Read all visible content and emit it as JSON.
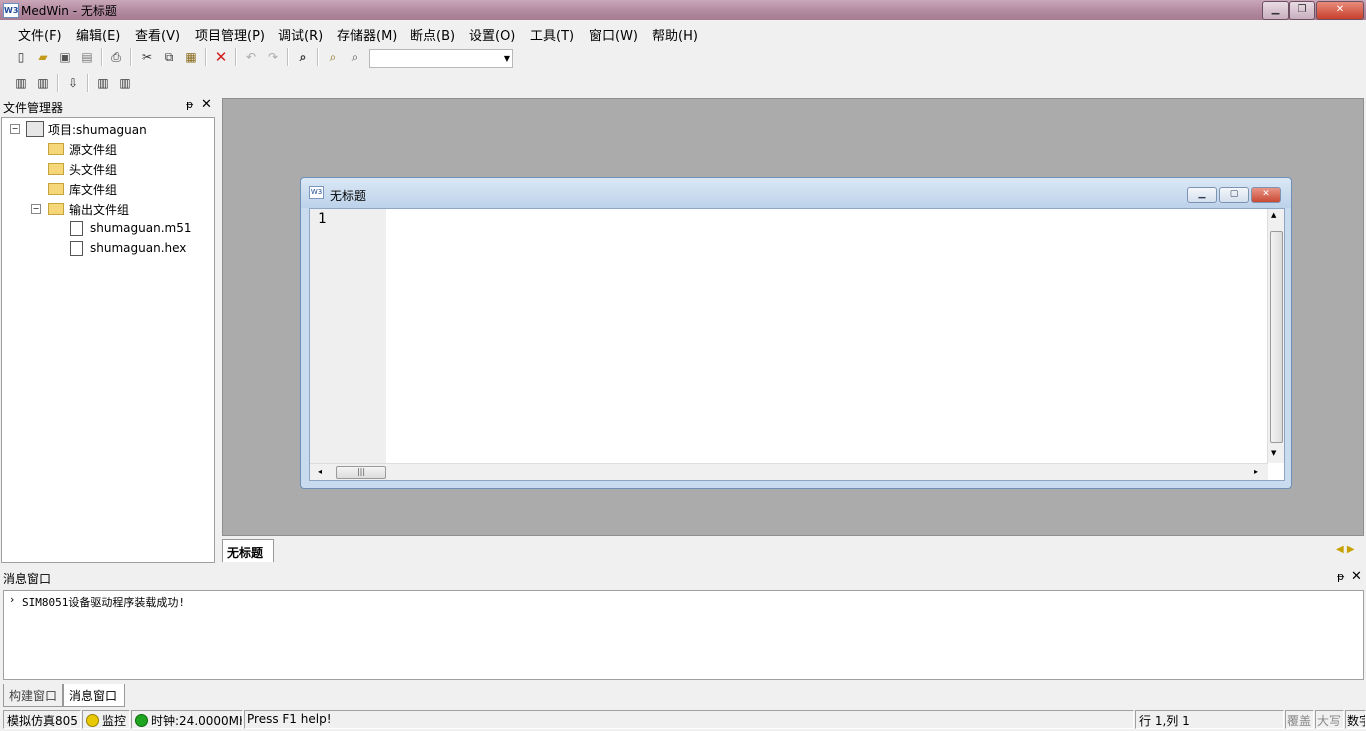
{
  "window": {
    "title": "MedWin - 无标题",
    "icon": "medwin-app-icon"
  },
  "menu": [
    "文件(F)",
    "编辑(E)",
    "查看(V)",
    "项目管理(P)",
    "调试(R)",
    "存储器(M)",
    "断点(B)",
    "设置(O)",
    "工具(T)",
    "窗口(W)",
    "帮助(H)"
  ],
  "toolbar": {
    "combo_value": ""
  },
  "file_manager": {
    "title": "文件管理器",
    "project": "项目:shumaguan",
    "groups": [
      "源文件组",
      "头文件组",
      "库文件组",
      "输出文件组"
    ],
    "output_files": [
      "shumaguan.m51",
      "shumaguan.hex"
    ]
  },
  "editor": {
    "title": "无标题",
    "line_numbers": [
      "1"
    ],
    "content": ""
  },
  "doc_tabs": [
    "无标题"
  ],
  "message_window": {
    "title": "消息窗口",
    "lines": [
      "SIM8051设备驱动程序装载成功!"
    ],
    "tabs": [
      "构建窗口",
      "消息窗口"
    ]
  },
  "status": {
    "mode": "模拟仿真805",
    "monitor": "监控",
    "clock": "时钟:24.0000MH",
    "help": "Press F1 help!",
    "position": "行 1,列 1",
    "overwrite": "覆盖",
    "caps": "大写",
    "num": "数字"
  },
  "colors": {
    "titlebar": "#b38aa0",
    "mdi_background": "#ababab",
    "child_frame": "#c9dcef",
    "monitor_led": "#e8c800",
    "clock_led": "#1ea41e"
  }
}
